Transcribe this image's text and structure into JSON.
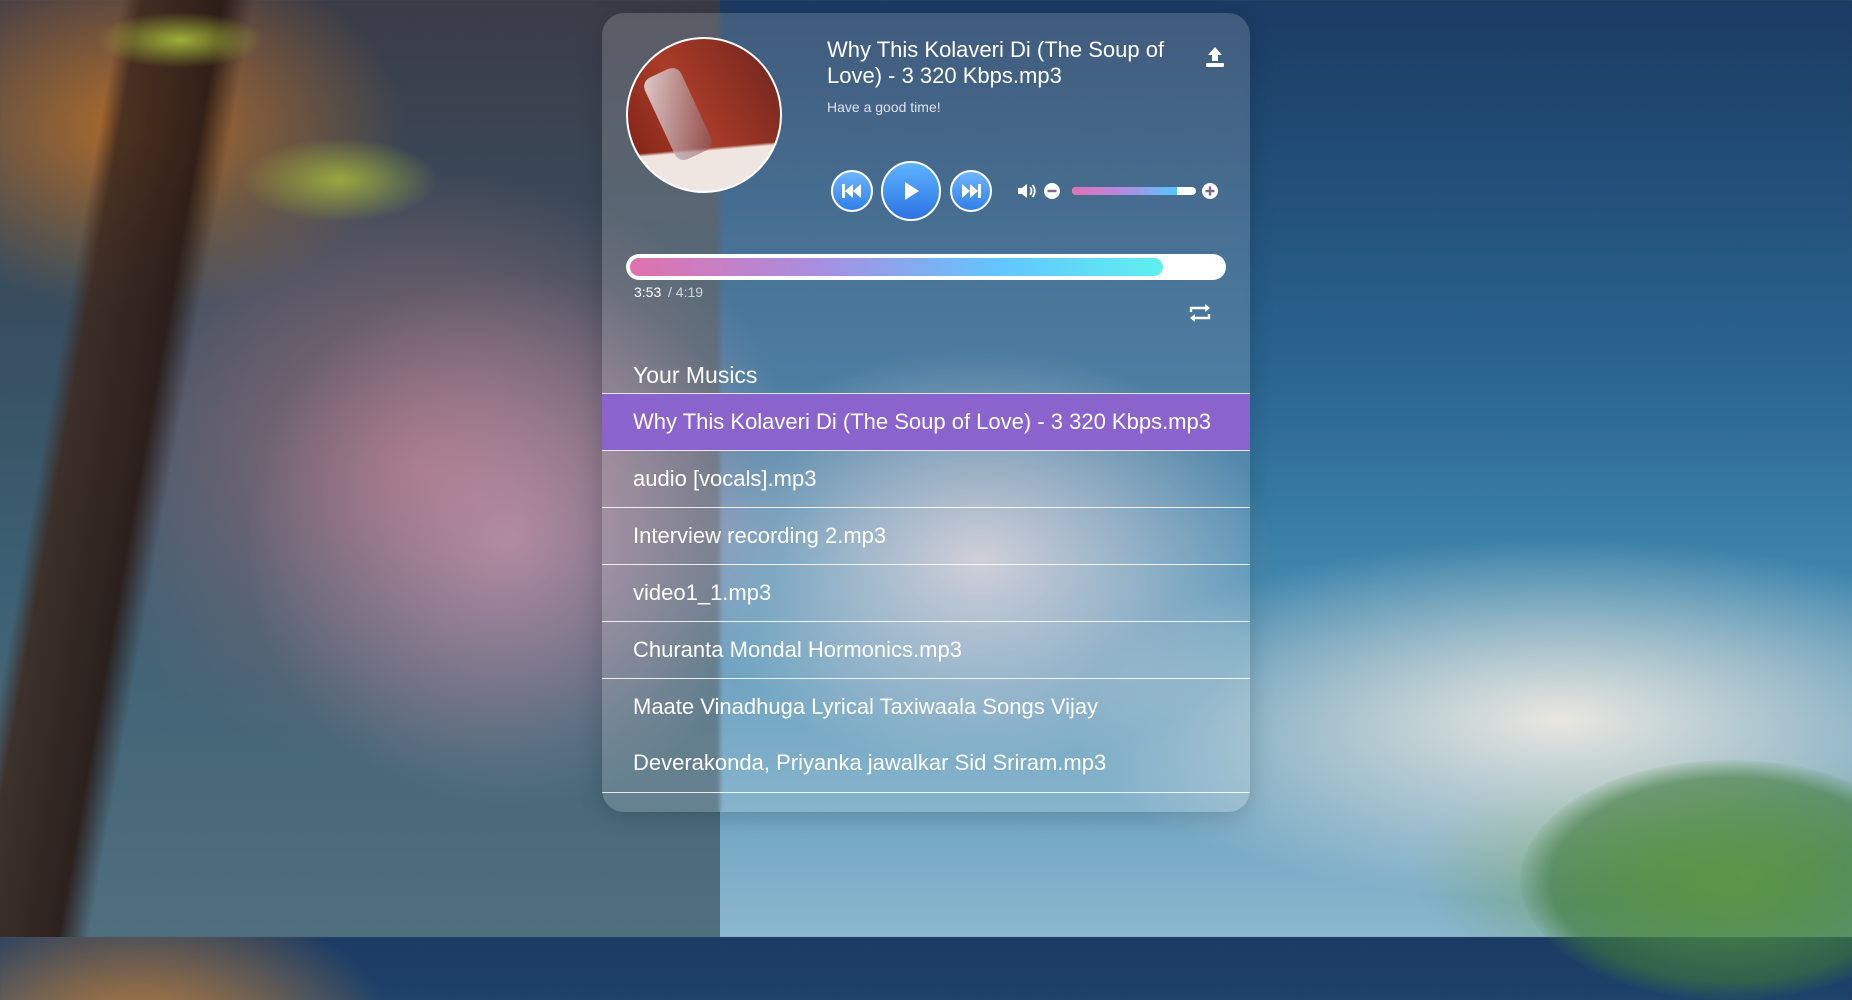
{
  "colors": {
    "accent_active": "#8b63cc",
    "control_blue": "#2f7fe8",
    "progress_gradient": [
      "#e072ad",
      "#a98ee0",
      "#62c6ff",
      "#5ff0ee"
    ]
  },
  "now_playing": {
    "title": "Why This Kolaveri Di (The Soup of Love) - 3 320 Kbps.mp3",
    "subtitle": "Have a good time!",
    "current_time": "3:53",
    "total_time": "/ 4:19",
    "progress_fraction": 0.9,
    "volume_fraction": 0.85
  },
  "icons": {
    "upload": "upload-icon",
    "prev": "skip-back-icon",
    "play": "play-icon",
    "next": "skip-forward-icon",
    "volume": "speaker-icon",
    "volume_down": "minus-circle-icon",
    "volume_up": "plus-circle-icon",
    "repeat": "repeat-icon"
  },
  "playlist": {
    "heading": "Your Musics",
    "items": [
      "Why This Kolaveri Di (The Soup of Love) - 3 320 Kbps.mp3",
      "audio [vocals].mp3",
      "Interview recording 2.mp3",
      "video1_1.mp3",
      "Churanta Mondal Hormonics.mp3",
      "Maate Vinadhuga Lyrical Taxiwaala Songs Vijay Deverakonda, Priyanka jawalkar Sid Sriram.mp3"
    ],
    "active_index": 0
  }
}
